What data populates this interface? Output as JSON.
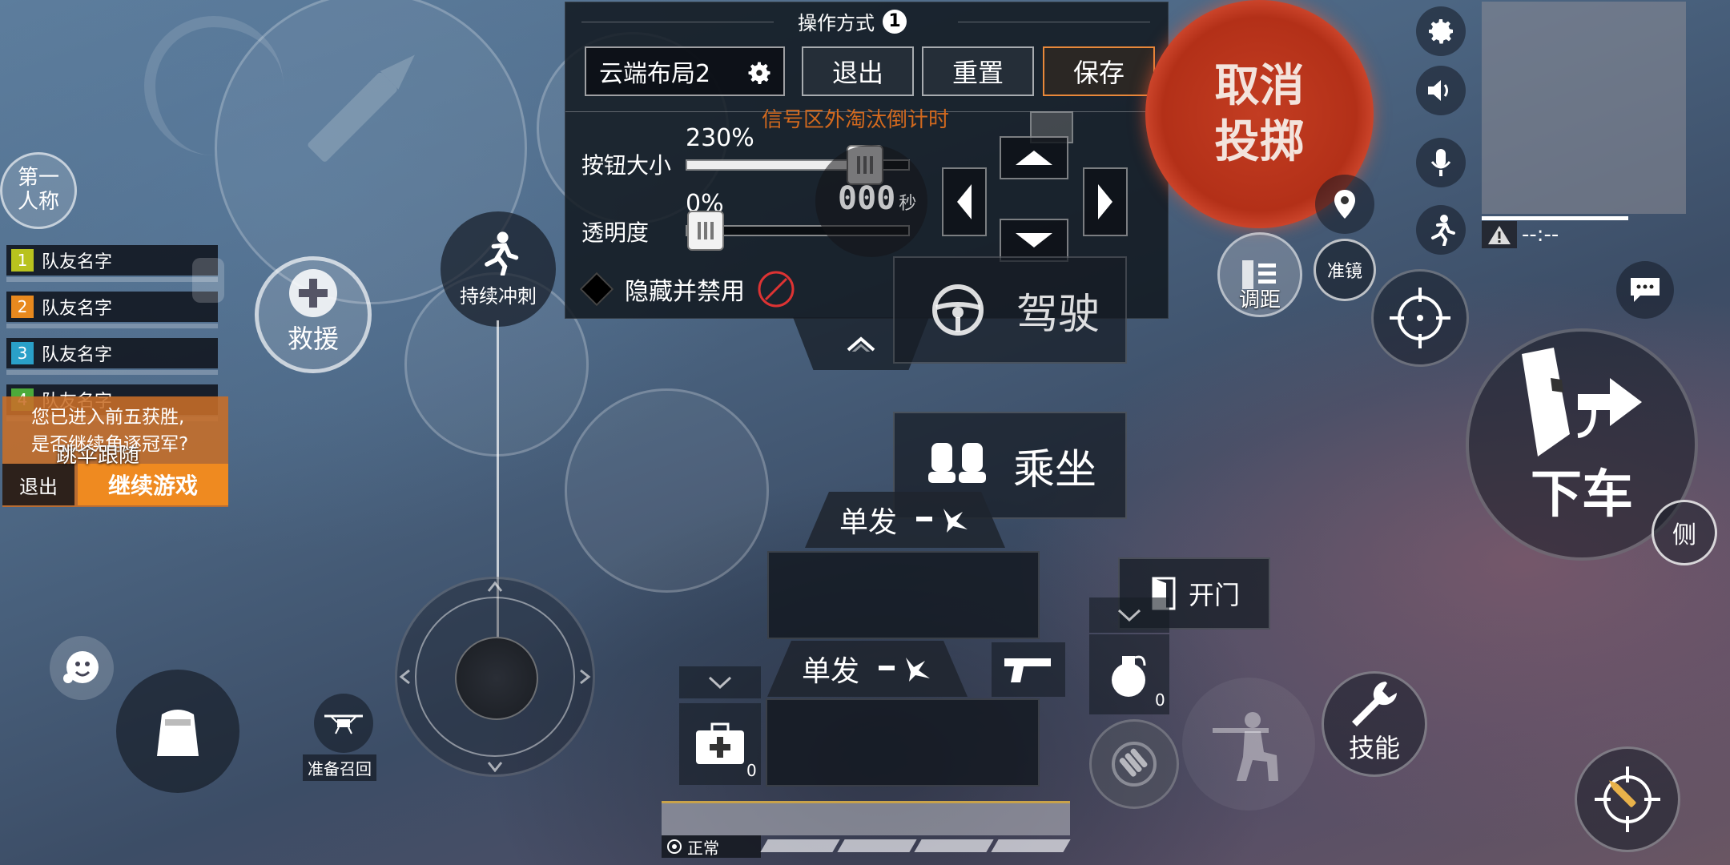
{
  "settings_panel": {
    "title": "操作方式",
    "title_badge": "1",
    "layout_name": "云端布局2",
    "exit_label": "退出",
    "reset_label": "重置",
    "save_label": "保存",
    "button_size_label": "按钮大小",
    "button_size_value": "230%",
    "button_size_level": 0.85,
    "opacity_label": "透明度",
    "opacity_value": "0%",
    "opacity_level": 0.0,
    "hide_disable_label": "隐藏并禁用",
    "signal_warning": "信号区外淘汰倒计时",
    "countdown_digits": "000",
    "countdown_unit": "秒",
    "accent_color": "#e8883a"
  },
  "hud": {
    "cancel_throw": "取消\n投掷",
    "perspective": "第一\n人称",
    "rescue": "救援",
    "sprint": "持续冲刺",
    "drive": "驾驶",
    "ride": "乘坐",
    "exit_vehicle": "下车",
    "side": "侧",
    "adjust_distance": "调距",
    "scope": "准镜",
    "skill": "技能",
    "open_door": "开门",
    "drone_recall": "准备召回",
    "fire_mode_top": "单发",
    "fire_mode_bottom": "单发",
    "medkit_count": "0",
    "grenade_count": "0",
    "status_normal": "正常",
    "minimap_time": "--:--",
    "ammo_count": "0"
  },
  "team": {
    "members": [
      {
        "num": "1",
        "name": "队友名字",
        "color": "#b8c21e"
      },
      {
        "num": "2",
        "name": "队友名字",
        "color": "#e8891e"
      },
      {
        "num": "3",
        "name": "队友名字",
        "color": "#2aa0c8"
      },
      {
        "num": "4",
        "name": "队友名字",
        "color": "#4caa3a"
      }
    ]
  },
  "top5_prompt": {
    "line1": "您已进入前五获胜,",
    "line2": "是否继续角逐冠军?",
    "parachute_follow": "跳伞跟随",
    "exit": "退出",
    "continue": "继续游戏"
  },
  "colors": {
    "cancel_red": "#c8381e",
    "continue_orange": "#ef8a20"
  }
}
